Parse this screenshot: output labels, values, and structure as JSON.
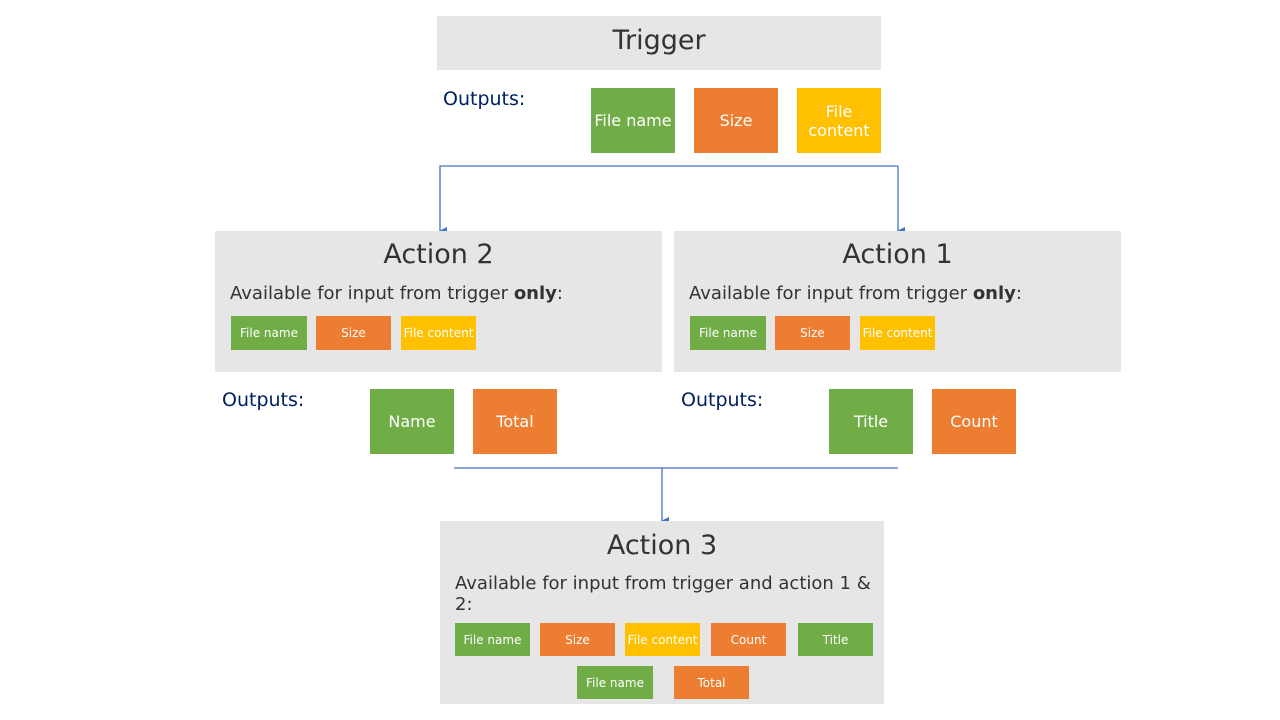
{
  "colors": {
    "panel": "#e6e6e6",
    "green": "#70ad47",
    "orange": "#ed7d31",
    "yellow": "#ffc000",
    "label": "#002060",
    "connector": "#4472c4"
  },
  "trigger": {
    "title": "Trigger",
    "outputs_label": "Outputs:",
    "outputs": [
      "File name",
      "Size",
      "File content"
    ]
  },
  "action2": {
    "title": "Action 2",
    "available_prefix": "Available for input from trigger ",
    "available_bold": "only",
    "available_suffix": ":",
    "inputs": [
      "File name",
      "Size",
      "File content"
    ],
    "outputs_label": "Outputs:",
    "outputs": [
      "Name",
      "Total"
    ]
  },
  "action1": {
    "title": "Action 1",
    "available_prefix": "Available for input from trigger ",
    "available_bold": "only",
    "available_suffix": ":",
    "inputs": [
      "File name",
      "Size",
      "File content"
    ],
    "outputs_label": "Outputs:",
    "outputs": [
      "Title",
      "Count"
    ]
  },
  "action3": {
    "title": "Action 3",
    "available": "Available for input from trigger and action 1 & 2:",
    "inputs": [
      "File name",
      "Size",
      "File content",
      "Count",
      "Title",
      "File name",
      "Total"
    ]
  }
}
